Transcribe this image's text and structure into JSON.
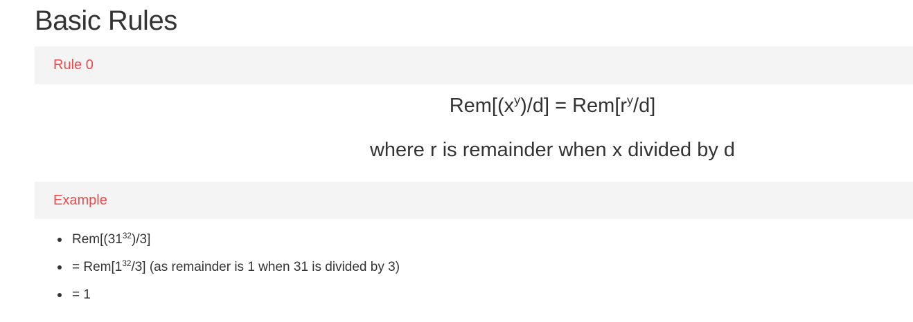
{
  "page": {
    "title": "Basic Rules"
  },
  "rule_section": {
    "label": "Rule 0",
    "formula": {
      "lhs_prefix": "Rem[(x",
      "lhs_exp": "y",
      "lhs_suffix": ")/d] = Rem[r",
      "rhs_exp": "y",
      "rhs_suffix": "/d]"
    },
    "note": "where r is remainder when x divided by d"
  },
  "example_section": {
    "label": "Example",
    "items": [
      {
        "prefix": "Rem[(31",
        "exp": "32",
        "suffix": ")/3]"
      },
      {
        "prefix": "= Rem[1",
        "exp": "32",
        "suffix": "/3] (as remainder is 1 when 31 is divided by 3)"
      },
      {
        "prefix": "= 1",
        "exp": "",
        "suffix": ""
      }
    ]
  },
  "colors": {
    "label_accent": "#ee4b4b",
    "band_background": "#f4f4f4",
    "text": "#333333"
  }
}
